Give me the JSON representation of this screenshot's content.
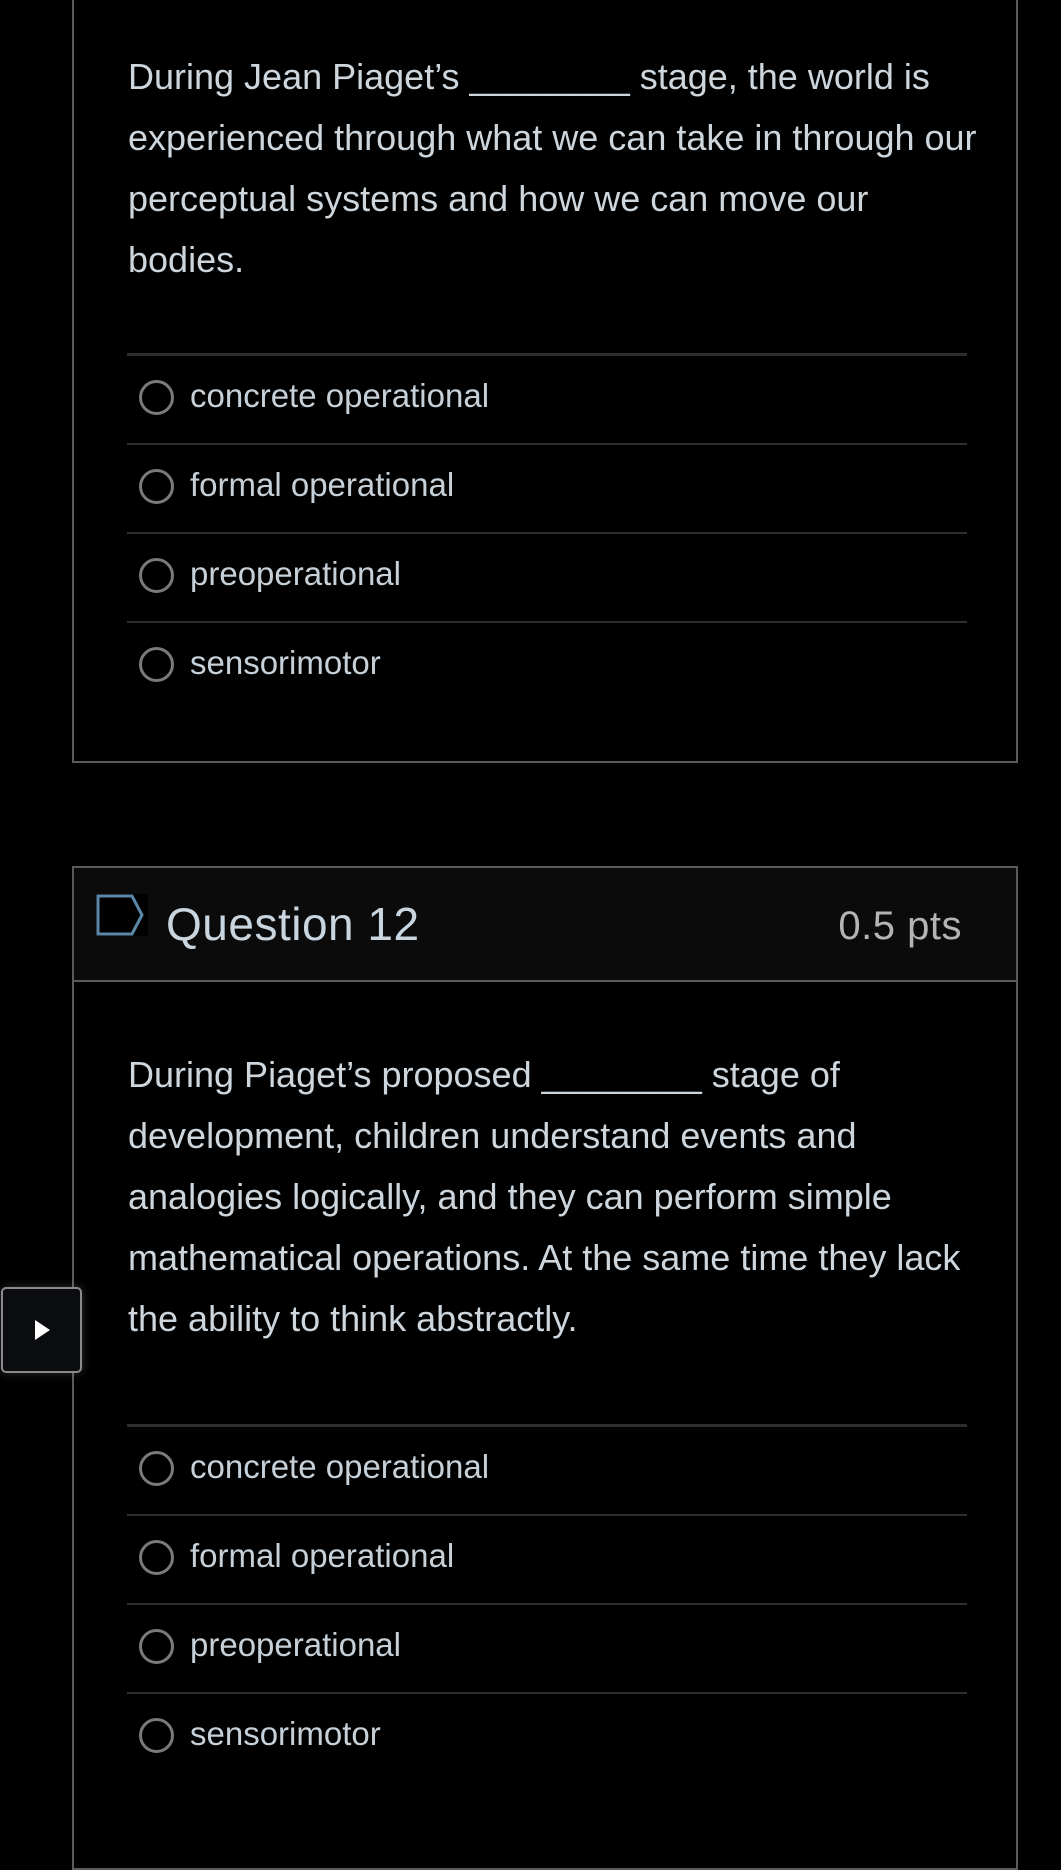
{
  "questions": [
    {
      "id": "q11",
      "text": "During Jean Piaget’s ________ stage, the world is experienced through what we can take in through our perceptual systems and how we can move our bodies.",
      "answers": [
        {
          "label": "concrete operational",
          "selected": false
        },
        {
          "label": "formal operational",
          "selected": false
        },
        {
          "label": "preoperational",
          "selected": false
        },
        {
          "label": "sensorimotor",
          "selected": false
        }
      ]
    },
    {
      "id": "q12",
      "title": "Question 12",
      "points": "0.5 pts",
      "flag_icon": "bookmark-flag-icon",
      "text": "During Piaget’s proposed ________ stage of development, children understand events and analogies logically, and they can perform simple mathematical operations. At the same time they lack the ability to think abstractly.",
      "answers": [
        {
          "label": "concrete operational",
          "selected": false
        },
        {
          "label": "formal operational",
          "selected": false
        },
        {
          "label": "preoperational",
          "selected": false
        },
        {
          "label": "sensorimotor",
          "selected": false
        }
      ]
    }
  ],
  "side_toggle": {
    "icon": "play-icon"
  },
  "colors": {
    "background": "#000000",
    "card_border": "#5a5a5a",
    "header_bg": "#0b0b0c",
    "flag_accent": "#5b88a8",
    "text": "#cdd6dd",
    "points_text": "#b4b4b4",
    "radio_border": "#7a7a7a",
    "divider": "#2e2e2e"
  }
}
